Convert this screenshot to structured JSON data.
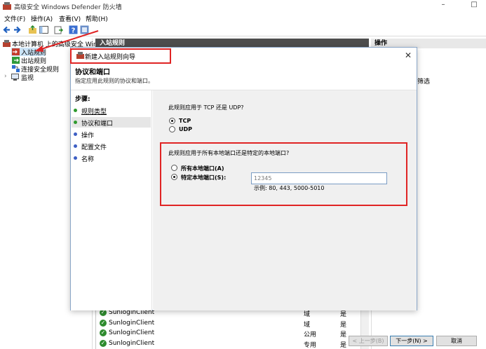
{
  "window": {
    "title": "高级安全 Windows Defender 防火墙",
    "minimize": "–",
    "maximize": "□"
  },
  "menu": [
    "文件(F)",
    "操作(A)",
    "查看(V)",
    "帮助(H)"
  ],
  "tree": {
    "root": "本地计算机 上的高级安全 Wind",
    "items": [
      "入站规则",
      "出站规则",
      "连接安全规则",
      "监视"
    ]
  },
  "middle": {
    "header": "入站规则",
    "rows": [
      {
        "name": "SunloginClient",
        "profile": "域",
        "enabled": "是"
      },
      {
        "name": "SunloginClient",
        "profile": "域",
        "enabled": "是"
      },
      {
        "name": "SunloginClient",
        "profile": "公用",
        "enabled": "是"
      },
      {
        "name": "SunloginClient",
        "profile": "专用",
        "enabled": "是"
      }
    ]
  },
  "actions": {
    "header": "操作",
    "snippet": "筛选"
  },
  "dialog": {
    "title": "新建入站规则向导",
    "close": "✕",
    "heading": "协议和端口",
    "subtitle": "指定应用此规则的协议和端口。",
    "steps_title": "步骤:",
    "steps": [
      "规则类型",
      "协议和端口",
      "操作",
      "配置文件",
      "名称"
    ],
    "active_step": 1,
    "protocol_question": "此规则应用于 TCP 还是 UDP?",
    "protocol_options": [
      "TCP",
      "UDP"
    ],
    "protocol_selected": "TCP",
    "ports_question": "此规则应用于所有本地端口还是特定的本地端口?",
    "port_options": [
      "所有本地端口(A)",
      "特定本地端口(S):"
    ],
    "port_selected": "特定本地端口(S):",
    "port_value": "12345",
    "port_example": "示例: 80, 443, 5000-5010",
    "buttons": {
      "back": "< 上一步(B)",
      "next": "下一步(N) >",
      "cancel": "取消"
    }
  },
  "colors": {
    "highlight": "#e02424",
    "step_dot_done": "#2e9a2e",
    "step_dot_pending": "#3d5fc4",
    "check_green": "#2e8b2e"
  }
}
